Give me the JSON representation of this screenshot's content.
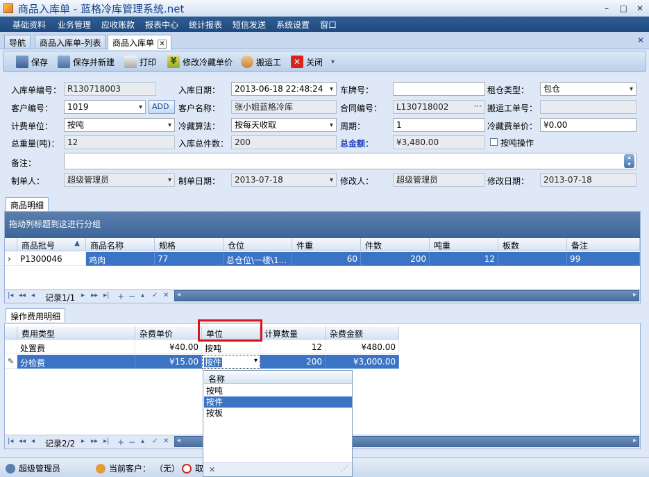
{
  "window": {
    "title": "商品入库单 - 蓝格冷库管理系统.net",
    "minimize": "–",
    "restore": "□",
    "close": "✕"
  },
  "menu": [
    "基础资料",
    "业务管理",
    "应收账款",
    "报表中心",
    "统计报表",
    "短信发送",
    "系统设置",
    "窗口"
  ],
  "doc_tabs": [
    {
      "label": "导航"
    },
    {
      "label": "商品入库单-列表"
    },
    {
      "label": "商品入库单",
      "close": "✕"
    }
  ],
  "tabstrip_close": "✕",
  "toolbar": {
    "save": "保存",
    "save_new": "保存并新建",
    "print": "打印",
    "modify_price": "修改冷藏单价",
    "porter": "搬运工",
    "close": "关闭",
    "more": "▾"
  },
  "colors": {
    "menubar": "#1f4a80",
    "selected_row": "#3b74c4",
    "highlight_box": "#d6161d",
    "total_label": "#1d3fbf"
  },
  "form": {
    "order_no_label": "入库单编号：",
    "order_no": "R130718003",
    "in_date_label": "入库日期：",
    "in_date": "2013-06-18  22:48:24",
    "plate_label": "车牌号：",
    "plate": "",
    "rent_type_label": "租仓类型：",
    "rent_type": "包仓",
    "customer_no_label": "客户编号：",
    "customer_no": "1019",
    "add_button": "ADD",
    "customer_name_label": "客户名称：",
    "customer_name": "张小姐蓝格冷库",
    "contract_no_label": "合同编号：",
    "contract_no": "L130718002",
    "contract_ellipsis": "···",
    "porter_no_label": "搬运工单号：",
    "porter_no": "",
    "billing_unit_label": "计费单位：",
    "billing_unit": "按吨",
    "cold_algo_label": "冷藏算法：",
    "cold_algo": "按每天收取",
    "period_label": "周期：",
    "period": "1",
    "cold_price_label": "冷藏费单价：",
    "cold_price": "¥0.00",
    "total_weight_label": "总重量(吨)：",
    "total_weight": "12",
    "total_pieces_label": "入库总件数：",
    "total_pieces": "200",
    "total_amount_label": "总金额：",
    "total_amount": "¥3,480.00",
    "by_ton_label": "按吨操作",
    "remark_label": "备注：",
    "remark": "",
    "maker_label": "制单人：",
    "maker": "超级管理员",
    "make_date_label": "制单日期：",
    "make_date": "2013-07-18",
    "modifier_label": "修改人：",
    "modifier": "超级管理员",
    "modify_date_label": "修改日期：",
    "modify_date": "2013-07-18"
  },
  "goods_section": {
    "tab": "商品明细",
    "group_hint": "拖动列标题到这进行分组",
    "columns": [
      "商品批号",
      "商品名称",
      "规格",
      "仓位",
      "件重",
      "件数",
      "吨重",
      "板数",
      "备注"
    ],
    "sort_indicator": "▲",
    "rows": [
      [
        "P1300046",
        "鸡肉",
        "77",
        "总仓位\\一楼\\1...",
        "60",
        "200",
        "12",
        "",
        "99"
      ]
    ],
    "row_indicator": "›",
    "record": "记录1/1"
  },
  "fee_section": {
    "tab": "操作费用明细",
    "columns": [
      "费用类型",
      "杂费单价",
      "单位",
      "计算数量",
      "杂费金额"
    ],
    "rows": [
      [
        "处置费",
        "¥40.00",
        "按吨",
        "12",
        "¥480.00"
      ],
      [
        "分检费",
        "¥15.00",
        "按件",
        "200",
        "¥3,000.00"
      ]
    ],
    "edit_indicator": "✎",
    "record": "记录2/2"
  },
  "nav_buttons": [
    "|◂",
    "◂◂",
    "◂",
    "▸",
    "▸▸",
    "▸|",
    "+",
    "−",
    "▴",
    "✓",
    "✕"
  ],
  "scroll_arrows": {
    "left": "◂",
    "right": "▸"
  },
  "dropdown": {
    "header": "名称",
    "items": [
      "按吨",
      "按件",
      "按板"
    ],
    "selected": "按件",
    "close": "✕",
    "grip": "⋰"
  },
  "remark_spin": {
    "up": "▴",
    "down": "▾"
  },
  "status": {
    "user": "超级管理员",
    "current_customer_label": "当前客户：",
    "current_customer": "（无）",
    "cancel": "取"
  }
}
